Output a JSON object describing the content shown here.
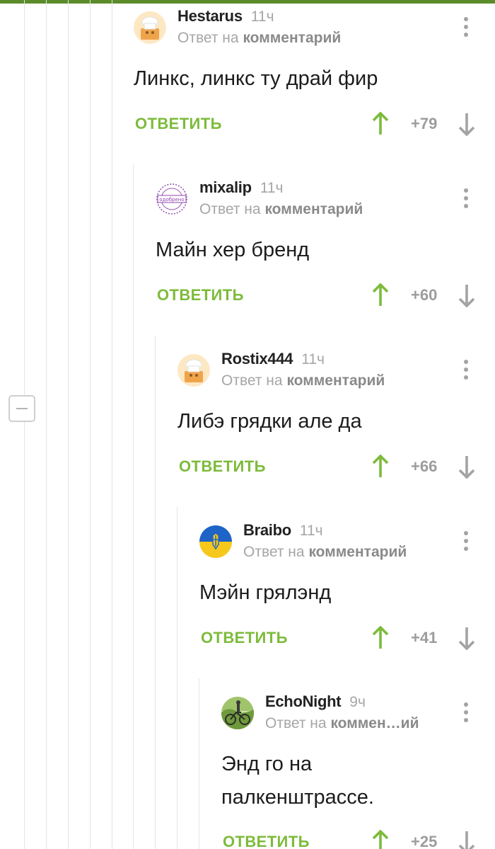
{
  "common": {
    "reply_label": "ОТВЕТИТЬ"
  },
  "comments": [
    {
      "author": "Hestarus",
      "time": "11ч",
      "reply_prefix": "Ответ на",
      "reply_target": "комментарий",
      "text": "Линкс, линкс ту драй фир",
      "rating": "+79",
      "avatar": "chef-avatar"
    },
    {
      "author": "mixalip",
      "time": "11ч",
      "reply_prefix": "Ответ на",
      "reply_target": "комментарий",
      "text": "Майн хер бренд",
      "rating": "+60",
      "avatar": "stamp-avatar",
      "avatar_text": "одобрено"
    },
    {
      "author": "Rostix444",
      "time": "11ч",
      "reply_prefix": "Ответ на",
      "reply_target": "комментарий",
      "text": "Либэ грядки але да",
      "rating": "+66",
      "avatar": "chef-avatar"
    },
    {
      "author": "Braibo",
      "time": "11ч",
      "reply_prefix": "Ответ на",
      "reply_target": "комментарий",
      "text": "Мэйн грялэнд",
      "rating": "+41",
      "avatar": "ukraine-flag-avatar"
    },
    {
      "author": "EchoNight",
      "time": "9ч",
      "reply_prefix": "Ответ на",
      "reply_target": "коммен…ий",
      "text": [
        "Энд го на",
        "палкенштрассе."
      ],
      "rating": "+25",
      "avatar": "cyclist-photo-avatar"
    }
  ],
  "colors": {
    "accent_green": "#7dbb3b",
    "top_bar": "#5b8c2a",
    "muted_gray": "#a6a6a6"
  }
}
